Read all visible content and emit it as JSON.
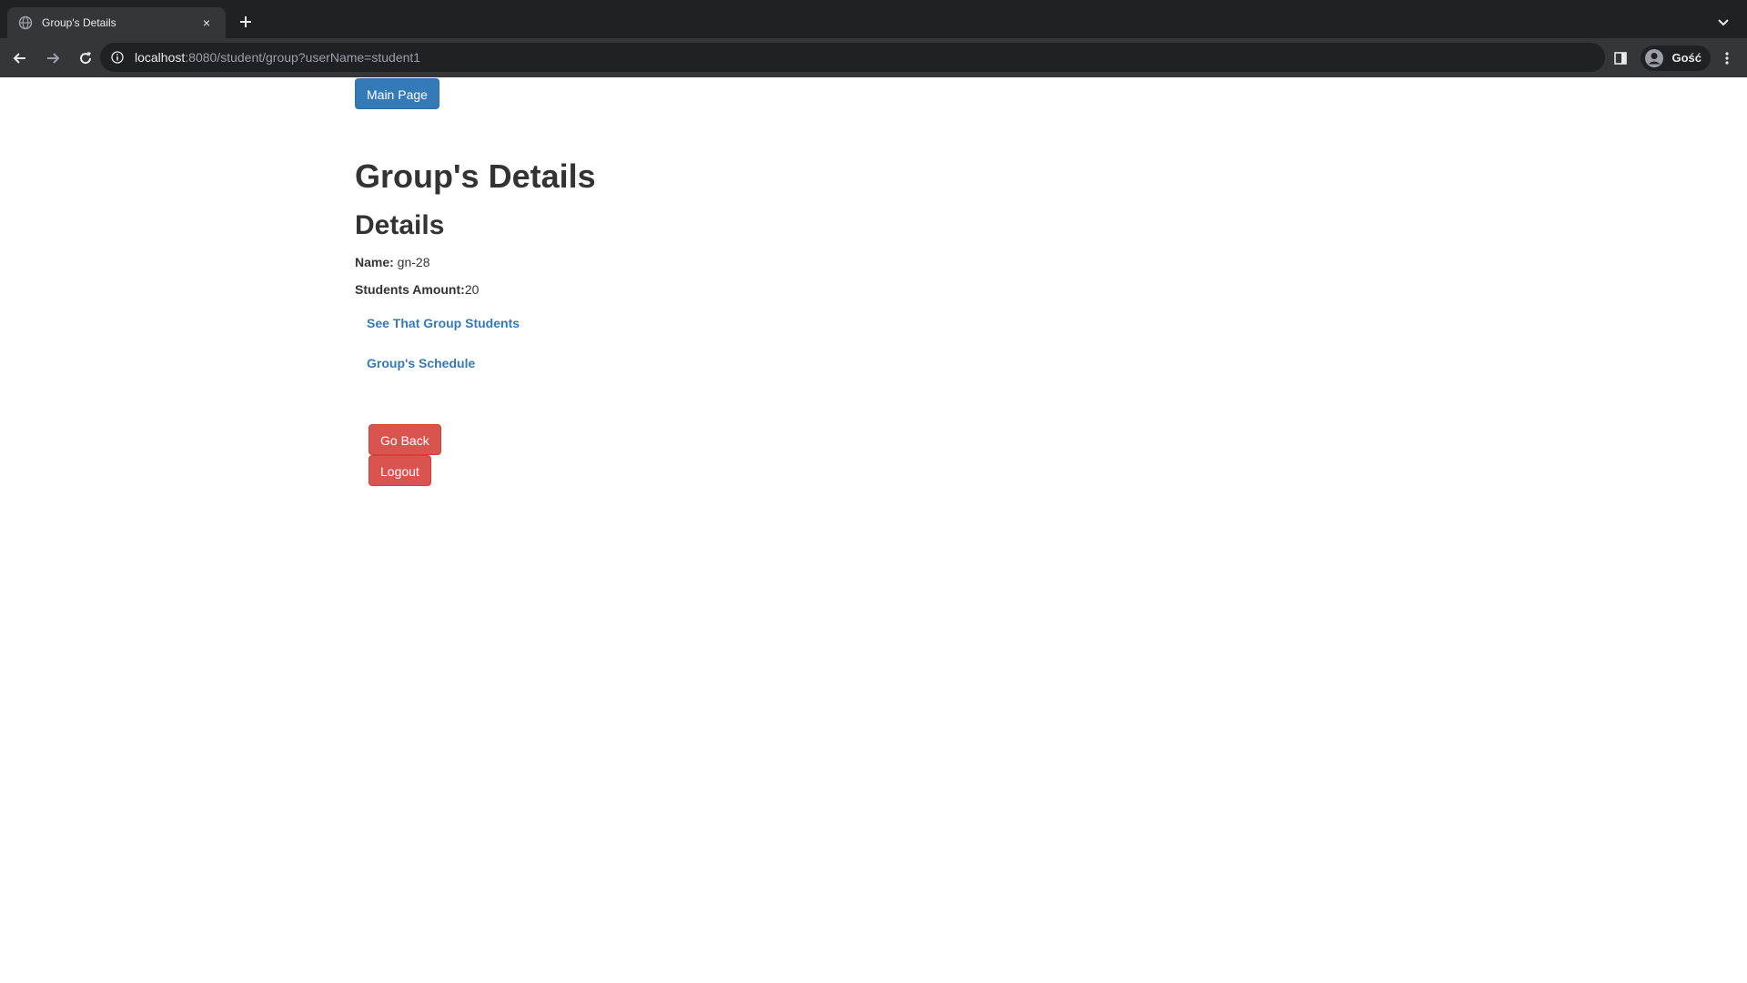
{
  "browser": {
    "tab_title": "Group's Details",
    "tab_close": "×",
    "url_host": "localhost",
    "url_rest": ":8080/student/group?userName=student1",
    "profile_name": "Gość",
    "icons": {
      "favicon": "globe-icon",
      "close": "close-icon",
      "new_tab": "plus-icon",
      "tab_search": "chevron-down-icon",
      "back": "arrow-left-icon",
      "forward": "arrow-right-icon",
      "reload": "reload-icon",
      "site_info": "info-icon",
      "side_panel": "side-panel-icon",
      "profile": "user-avatar-icon",
      "menu": "kebab-menu-icon"
    }
  },
  "page": {
    "main_page_button": "Main Page",
    "title": "Group's Details",
    "subtitle": "Details",
    "name_label": "Name:",
    "name_value": " gn-28",
    "students_amount_label": "Students Amount:",
    "students_amount_value": "20",
    "see_students_link": "See That Group Students",
    "schedule_link": "Group's Schedule",
    "go_back_button": "Go Back",
    "logout_button": "Logout"
  },
  "colors": {
    "chrome_dark": "#202124",
    "chrome_toolbar": "#35363a",
    "primary": "#337ab7",
    "danger": "#d9534f",
    "text": "#333333"
  }
}
